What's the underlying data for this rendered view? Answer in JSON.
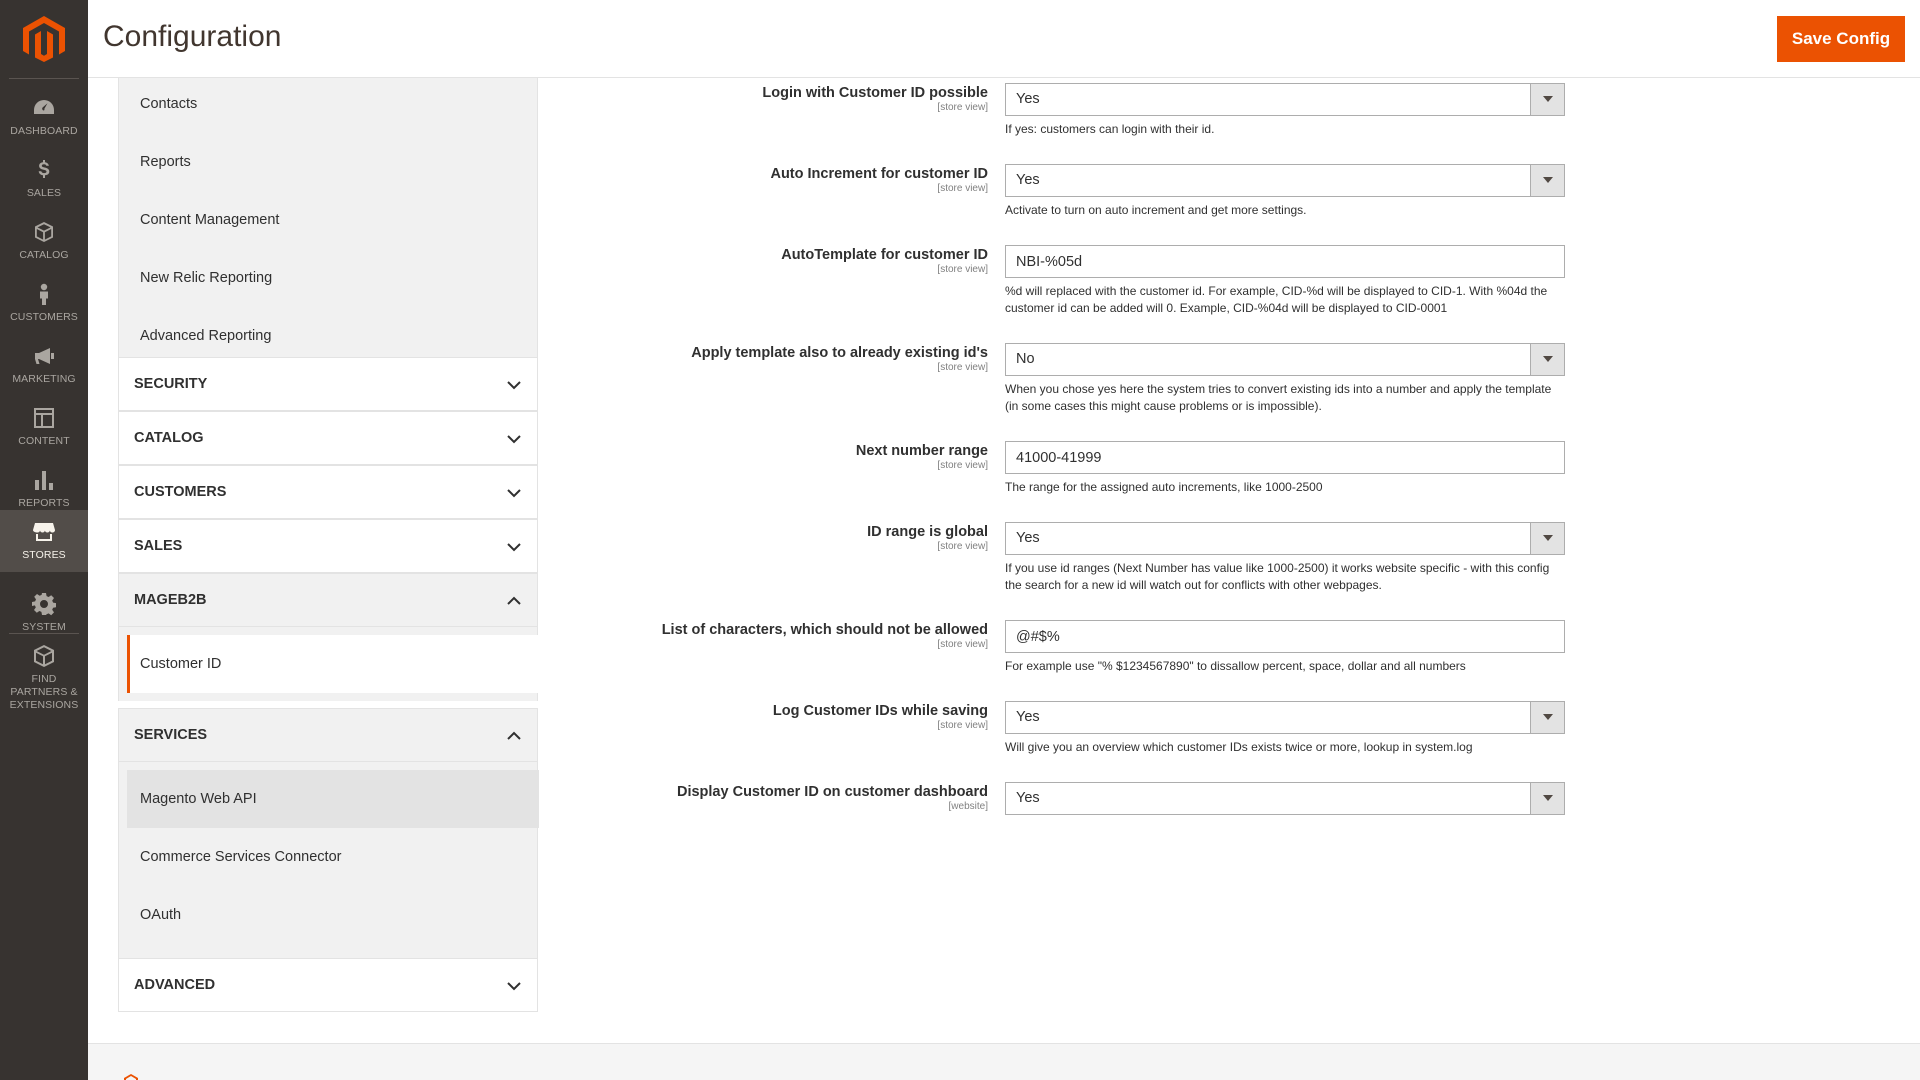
{
  "brand": {
    "accent": "#eb5202",
    "nav_bg": "#373330",
    "logo_color": "#eb5202"
  },
  "header": {
    "title": "Configuration",
    "save_label": "Save Config"
  },
  "admin_nav": [
    {
      "label": "DASHBOARD",
      "icon": "dashboard-icon",
      "active": false
    },
    {
      "label": "SALES",
      "icon": "dollar-icon",
      "active": false
    },
    {
      "label": "CATALOG",
      "icon": "box-icon",
      "active": false
    },
    {
      "label": "CUSTOMERS",
      "icon": "person-icon",
      "active": false
    },
    {
      "label": "MARKETING",
      "icon": "megaphone-icon",
      "active": false
    },
    {
      "label": "CONTENT",
      "icon": "layout-icon",
      "active": false
    },
    {
      "label": "REPORTS",
      "icon": "bar-chart-icon",
      "active": false
    },
    {
      "label": "STORES",
      "icon": "storefront-icon",
      "active": true
    },
    {
      "label": "SYSTEM",
      "icon": "gear-icon",
      "active": false
    },
    {
      "label": "FIND PARTNERS & EXTENSIONS",
      "icon": "cubes-icon",
      "active": false
    }
  ],
  "config_tabs": {
    "top_items": [
      "Contacts",
      "Reports",
      "Content Management",
      "New Relic Reporting",
      "Advanced Reporting"
    ],
    "sections": {
      "security": "SECURITY",
      "catalog": "CATALOG",
      "customers": "CUSTOMERS",
      "sales": "SALES",
      "mageb2b": "MAGEB2B",
      "services": "SERVICES",
      "advanced": "ADVANCED"
    },
    "mageb2b_items": [
      "Customer ID"
    ],
    "services_items": [
      "Magento Web API",
      "Commerce Services Connector",
      "OAuth"
    ]
  },
  "form": {
    "fields": [
      {
        "label": "Login with Customer ID possible",
        "scope": "[store view]",
        "type": "select",
        "value": "Yes",
        "note": "If yes: customers can login with their id."
      },
      {
        "label": "Auto Increment for customer ID",
        "scope": "[store view]",
        "type": "select",
        "value": "Yes",
        "note": "Activate to turn on auto increment and get more settings."
      },
      {
        "label": "AutoTemplate for customer ID",
        "scope": "[store view]",
        "type": "text",
        "value": "NBI-%05d",
        "note": "%d will replaced with the customer id. For example, CID-%d will be displayed to CID-1. With %04d the customer id can be added will 0. Example, CID-%04d will be displayed to CID-0001"
      },
      {
        "label": "Apply template also to already existing id's",
        "scope": "[store view]",
        "type": "select",
        "value": "No",
        "note": "When you chose yes here the system tries to convert existing ids into a number and apply the template (in some cases this might cause problems or is impossible)."
      },
      {
        "label": "Next number range",
        "scope": "[store view]",
        "type": "text",
        "value": "41000-41999",
        "note": "The range for the assigned auto increments, like 1000-2500"
      },
      {
        "label": "ID range is global",
        "scope": "[store view]",
        "type": "select",
        "value": "Yes",
        "note": "If you use id ranges (Next Number has value like 1000-2500) it works website specific - with this config the search for a new id will watch out for conflicts with other webpages."
      },
      {
        "label": "List of characters, which should not be allowed",
        "scope": "[store view]",
        "type": "text",
        "value": "@#$%",
        "note": "For example use \"% $1234567890\" to dissallow percent, space, dollar and all numbers"
      },
      {
        "label": "Log Customer IDs while saving",
        "scope": "[store view]",
        "type": "select",
        "value": "Yes",
        "note": "Will give you an overview which customer IDs exists twice or more, lookup in system.log"
      },
      {
        "label": "Display Customer ID on customer dashboard",
        "scope": "[website]",
        "type": "select",
        "value": "Yes",
        "note": ""
      }
    ]
  }
}
